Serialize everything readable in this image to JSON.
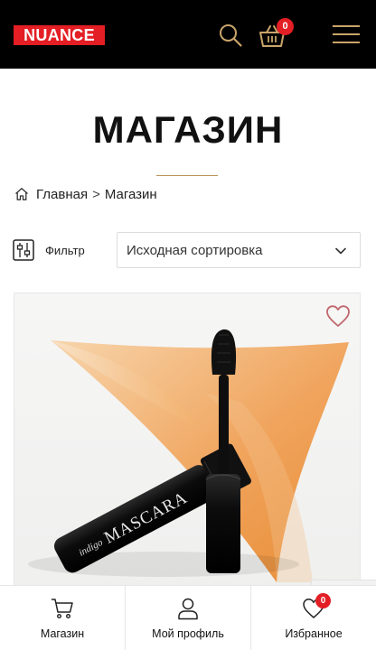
{
  "header": {
    "logo_text": "NUANCE",
    "search_icon": "search-icon",
    "cart_icon": "basket-icon",
    "cart_count": "0",
    "menu_icon": "hamburger-menu-icon",
    "colors": {
      "background": "#000000",
      "brand": "#e31e24",
      "icon_accent": "#c9a46a"
    }
  },
  "page": {
    "title": "МАГАЗИН"
  },
  "breadcrumb": {
    "home_icon": "home-icon",
    "home": "Главная",
    "separator": ">",
    "current": "Магазин"
  },
  "toolbar": {
    "filter_icon": "filter-sliders-icon",
    "filter_label": "Фильтр",
    "sort_selected": "Исходная сортировка"
  },
  "product": {
    "brand_text": "indigo",
    "name_text": "MASCARA",
    "wishlist_icon": "heart-icon"
  },
  "bottom_nav": {
    "items": [
      {
        "label": "Магазин",
        "icon": "cart-icon"
      },
      {
        "label": "Мой профиль",
        "icon": "user-icon"
      },
      {
        "label": "Избранное",
        "icon": "heart-icon",
        "badge": "0"
      }
    ]
  }
}
